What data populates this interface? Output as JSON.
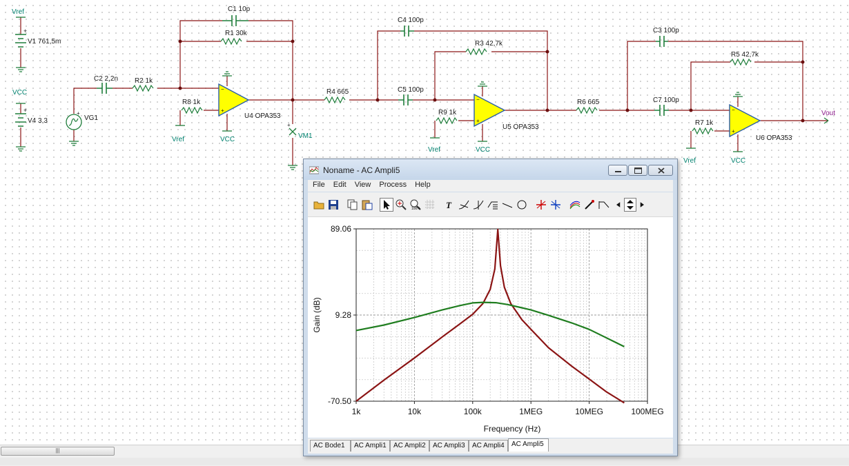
{
  "schematic": {
    "components": {
      "v1": "V1 761,5m",
      "v4": "V4 3,3",
      "vg1": "VG1",
      "c2": "C2 2,2n",
      "r2": "R2 1k",
      "c1": "C1 10p",
      "r1": "R1 30k",
      "r8": "R8 1k",
      "u4": "U4 OPA353",
      "vm1": "VM1",
      "r4": "R4 665",
      "c4": "C4 100p",
      "r3": "R3 42,7k",
      "c5": "C5 100p",
      "r9": "R9 1k",
      "u5": "U5 OPA353",
      "r6": "R6 665",
      "c3": "C3 100p",
      "r5": "R5 42,7k",
      "c7": "C7 100p",
      "r7": "R7 1k",
      "u6": "U6 OPA353"
    },
    "nets": {
      "vref": "Vref",
      "vcc": "VCC",
      "vout": "Vout"
    },
    "colors": {
      "wire": "#8b1414",
      "net_label": "#00806e",
      "opamp_fill": "#ffff00",
      "opamp_stroke": "#2a5ea8",
      "vout": "#8a1a8a"
    }
  },
  "window": {
    "title": "Noname - AC Ampli5",
    "menu": [
      "File",
      "Edit",
      "View",
      "Process",
      "Help"
    ],
    "toolbar_icons": [
      "open-folder-icon",
      "save-icon",
      "copy-icon",
      "paste-icon",
      "pointer-icon",
      "zoom-in-icon",
      "zoom-100-icon",
      "grid-icon",
      "text-icon",
      "tangent-icon",
      "cursor-icon",
      "add-curve-icon",
      "line-icon",
      "circle-icon",
      "cursor-a-icon",
      "cursor-b-icon",
      "curves-icon",
      "marker-icon",
      "step-icon",
      "nav-left-icon",
      "nav-up-down-icon",
      "nav-right-icon"
    ],
    "tabs": [
      "AC Bode1",
      "AC Ampli1",
      "AC Ampli2",
      "AC Ampli3",
      "AC Ampli4",
      "AC Ampli5"
    ],
    "active_tab": "AC Ampli5"
  },
  "chart_data": {
    "type": "line",
    "xlabel": "Frequency (Hz)",
    "ylabel": "Gain (dB)",
    "x_scale": "log",
    "xlim": [
      1000,
      100000000
    ],
    "ylim": [
      -70.5,
      89.06
    ],
    "x_ticks": [
      "1k",
      "10k",
      "100k",
      "1MEG",
      "10MEG",
      "100MEG"
    ],
    "y_ticks": [
      "89.06",
      "9.28",
      "-70.50"
    ],
    "grid": true,
    "series": [
      {
        "color": "#8b1414",
        "x": [
          1000,
          3000,
          10000,
          30000,
          60000,
          100000,
          150000,
          200000,
          240000,
          270000,
          300000,
          350000,
          450000,
          700000,
          1000000,
          2000000,
          5000000,
          10000000,
          20000000,
          40000000
        ],
        "y": [
          -70.5,
          -51,
          -30.5,
          -11,
          1,
          10,
          20,
          33,
          52,
          88.5,
          55,
          35,
          20,
          5,
          -4,
          -21,
          -38,
          -50,
          -62,
          -72
        ]
      },
      {
        "color": "#1f7d1f",
        "x": [
          1000,
          3000,
          10000,
          30000,
          60000,
          100000,
          150000,
          250000,
          400000,
          700000,
          1000000,
          2000000,
          5000000,
          10000000,
          20000000,
          40000000
        ],
        "y": [
          -5,
          0,
          7,
          14,
          18,
          20.5,
          21,
          20.7,
          19,
          16,
          14,
          9,
          2,
          -4,
          -12,
          -20
        ]
      }
    ]
  }
}
